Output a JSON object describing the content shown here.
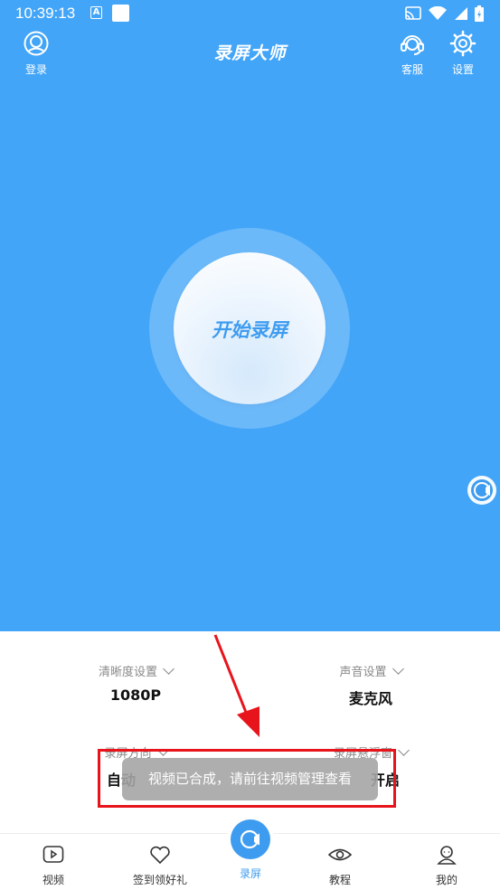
{
  "status_bar": {
    "time": "10:39:13",
    "a_glyph": "A"
  },
  "header": {
    "title": "录屏大师",
    "login_label": "登录",
    "service_label": "客服",
    "settings_label": "设置"
  },
  "record_button": {
    "label": "开始录屏"
  },
  "settings": {
    "quality": {
      "label": "清晰度设置",
      "value": "1080P"
    },
    "audio": {
      "label": "声音设置",
      "value": "麦克风"
    },
    "orientation": {
      "label": "录屏方向",
      "value": "自动"
    },
    "floating": {
      "label": "录屏悬浮窗",
      "value": "开启"
    }
  },
  "toast": {
    "text": "视频已合成，请前往视频管理查看"
  },
  "bottom_nav": {
    "items": [
      {
        "label": "视频",
        "icon": "video-icon"
      },
      {
        "label": "签到领好礼",
        "icon": "heart-icon"
      },
      {
        "label": "录屏",
        "icon": "record-icon"
      },
      {
        "label": "教程",
        "icon": "eye-icon"
      },
      {
        "label": "我的",
        "icon": "user-icon"
      }
    ]
  },
  "colors": {
    "primary": "#42a5f8",
    "accent": "#3e9cf0",
    "annotation": "#e8141c"
  }
}
